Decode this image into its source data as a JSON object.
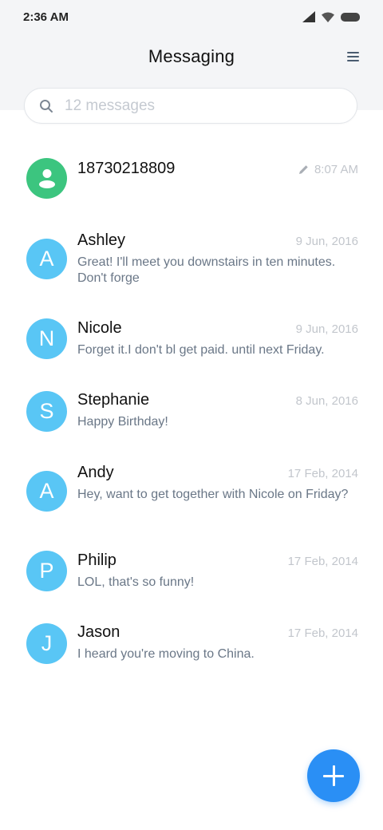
{
  "status_bar": {
    "time": "2:36 AM",
    "icons": [
      "signal-icon",
      "wifi-icon",
      "battery-icon"
    ]
  },
  "header": {
    "title": "Messaging",
    "menu_icon": "menu-icon"
  },
  "search": {
    "placeholder": "12 messages",
    "value": ""
  },
  "colors": {
    "accent": "#2a8ff5",
    "avatar_blue": "#59c6f5",
    "avatar_green": "#3cc57f"
  },
  "conversations": [
    {
      "name": "18730218809",
      "date": "8:07 AM",
      "preview": "",
      "avatar_letter": "",
      "avatar_icon": "person-icon",
      "draft_icon": "pencil-icon"
    },
    {
      "name": "Ashley",
      "date": "9 Jun, 2016",
      "preview": "Great! I'll meet you downstairs in ten minutes. Don't forge",
      "avatar_letter": "A"
    },
    {
      "name": "Nicole",
      "date": "9 Jun, 2016",
      "preview": "Forget it.I don't bl get paid. until next Friday.",
      "avatar_letter": "N"
    },
    {
      "name": "Stephanie",
      "date": "8 Jun, 2016",
      "preview": "Happy Birthday!",
      "avatar_letter": "S"
    },
    {
      "name": "Andy",
      "date": "17 Feb, 2014",
      "preview": "Hey, want to get together with Nicole on Friday?",
      "avatar_letter": "A"
    },
    {
      "name": "Philip",
      "date": "17 Feb, 2014",
      "preview": "LOL, that's so funny!",
      "avatar_letter": "P"
    },
    {
      "name": "Jason",
      "date": "17 Feb, 2014",
      "preview": "I heard you're moving to China.",
      "avatar_letter": "J"
    }
  ],
  "fab": {
    "icon": "plus-icon"
  }
}
